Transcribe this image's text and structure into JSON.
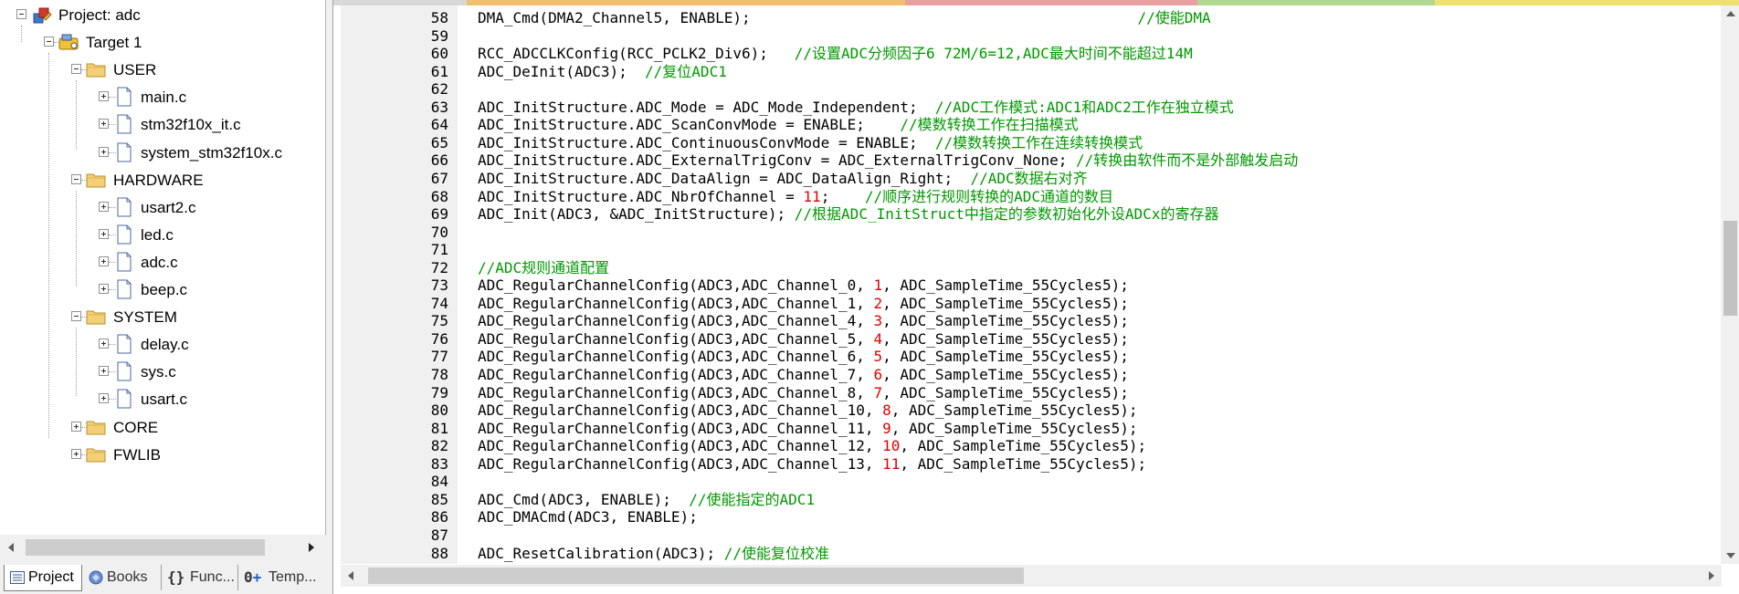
{
  "project_tree": [
    {
      "label": "Project: adc",
      "level": 0,
      "toggle": "minus",
      "icon": "project-icon"
    },
    {
      "label": "Target 1",
      "level": 1,
      "toggle": "minus",
      "icon": "target-icon"
    },
    {
      "label": "USER",
      "level": 2,
      "toggle": "minus",
      "icon": "folder-icon"
    },
    {
      "label": "main.c",
      "level": 3,
      "toggle": "plus",
      "icon": "file-icon"
    },
    {
      "label": "stm32f10x_it.c",
      "level": 3,
      "toggle": "plus",
      "icon": "file-icon"
    },
    {
      "label": "system_stm32f10x.c",
      "level": 3,
      "toggle": "plus",
      "icon": "file-icon"
    },
    {
      "label": "HARDWARE",
      "level": 2,
      "toggle": "minus",
      "icon": "folder-icon"
    },
    {
      "label": "usart2.c",
      "level": 3,
      "toggle": "plus",
      "icon": "file-icon"
    },
    {
      "label": "led.c",
      "level": 3,
      "toggle": "plus",
      "icon": "file-icon"
    },
    {
      "label": "adc.c",
      "level": 3,
      "toggle": "plus",
      "icon": "file-icon"
    },
    {
      "label": "beep.c",
      "level": 3,
      "toggle": "plus",
      "icon": "file-icon"
    },
    {
      "label": "SYSTEM",
      "level": 2,
      "toggle": "minus",
      "icon": "folder-icon"
    },
    {
      "label": "delay.c",
      "level": 3,
      "toggle": "plus",
      "icon": "file-icon"
    },
    {
      "label": "sys.c",
      "level": 3,
      "toggle": "plus",
      "icon": "file-icon"
    },
    {
      "label": "usart.c",
      "level": 3,
      "toggle": "plus",
      "icon": "file-icon"
    },
    {
      "label": "CORE",
      "level": 2,
      "toggle": "plus",
      "icon": "folder-icon"
    },
    {
      "label": "FWLIB",
      "level": 2,
      "toggle": "plus",
      "icon": "folder-icon"
    }
  ],
  "tabs": [
    {
      "label": "Project",
      "icon": "project-tab-icon",
      "active": true
    },
    {
      "label": "Books",
      "icon": "books-icon",
      "active": false
    },
    {
      "label": "Func...",
      "icon": "functions-icon",
      "active": false
    },
    {
      "label": "Temp...",
      "icon": "templates-icon",
      "active": false
    }
  ],
  "colors": {
    "comment": "#009900",
    "number": "#e00000",
    "text": "#000000"
  },
  "code_lines": [
    {
      "n": "58",
      "parts": [
        [
          "t",
          "DMA_Cmd(DMA2_Channel5, ENABLE);                                            "
        ],
        [
          "c",
          "//使能DMA"
        ]
      ]
    },
    {
      "n": "59",
      "parts": []
    },
    {
      "n": "60",
      "parts": [
        [
          "t",
          "RCC_ADCCLKConfig(RCC_PCLK2_Div6);   "
        ],
        [
          "c",
          "//设置ADC分频因子6 72M/6=12,ADC最大时间不能超过14M"
        ]
      ]
    },
    {
      "n": "61",
      "parts": [
        [
          "t",
          "ADC_DeInit(ADC3);  "
        ],
        [
          "c",
          "//复位ADC1"
        ]
      ]
    },
    {
      "n": "62",
      "parts": []
    },
    {
      "n": "63",
      "parts": [
        [
          "t",
          "ADC_InitStructure.ADC_Mode = ADC_Mode_Independent;  "
        ],
        [
          "c",
          "//ADC工作模式:ADC1和ADC2工作在独立模式"
        ]
      ]
    },
    {
      "n": "64",
      "parts": [
        [
          "t",
          "ADC_InitStructure.ADC_ScanConvMode = ENABLE;    "
        ],
        [
          "c",
          "//模数转换工作在扫描模式"
        ]
      ]
    },
    {
      "n": "65",
      "parts": [
        [
          "t",
          "ADC_InitStructure.ADC_ContinuousConvMode = ENABLE;  "
        ],
        [
          "c",
          "//模数转换工作在连续转换模式"
        ]
      ]
    },
    {
      "n": "66",
      "parts": [
        [
          "t",
          "ADC_InitStructure.ADC_ExternalTrigConv = ADC_ExternalTrigConv_None; "
        ],
        [
          "c",
          "//转换由软件而不是外部触发启动"
        ]
      ]
    },
    {
      "n": "67",
      "parts": [
        [
          "t",
          "ADC_InitStructure.ADC_DataAlign = ADC_DataAlign_Right;  "
        ],
        [
          "c",
          "//ADC数据右对齐"
        ]
      ]
    },
    {
      "n": "68",
      "parts": [
        [
          "t",
          "ADC_InitStructure.ADC_NbrOfChannel = "
        ],
        [
          "n",
          "11"
        ],
        [
          "t",
          ";    "
        ],
        [
          "c",
          "//顺序进行规则转换的ADC通道的数目"
        ]
      ]
    },
    {
      "n": "69",
      "parts": [
        [
          "t",
          "ADC_Init(ADC3, &ADC_InitStructure); "
        ],
        [
          "c",
          "//根据ADC_InitStruct中指定的参数初始化外设ADCx的寄存器"
        ]
      ]
    },
    {
      "n": "70",
      "parts": []
    },
    {
      "n": "71",
      "parts": []
    },
    {
      "n": "72",
      "parts": [
        [
          "c",
          "//ADC规则通道配置"
        ]
      ]
    },
    {
      "n": "73",
      "parts": [
        [
          "t",
          "ADC_RegularChannelConfig(ADC3,ADC_Channel_0, "
        ],
        [
          "n",
          "1"
        ],
        [
          "t",
          ", ADC_SampleTime_55Cycles5);"
        ]
      ]
    },
    {
      "n": "74",
      "parts": [
        [
          "t",
          "ADC_RegularChannelConfig(ADC3,ADC_Channel_1, "
        ],
        [
          "n",
          "2"
        ],
        [
          "t",
          ", ADC_SampleTime_55Cycles5);"
        ]
      ]
    },
    {
      "n": "75",
      "parts": [
        [
          "t",
          "ADC_RegularChannelConfig(ADC3,ADC_Channel_4, "
        ],
        [
          "n",
          "3"
        ],
        [
          "t",
          ", ADC_SampleTime_55Cycles5);"
        ]
      ]
    },
    {
      "n": "76",
      "parts": [
        [
          "t",
          "ADC_RegularChannelConfig(ADC3,ADC_Channel_5, "
        ],
        [
          "n",
          "4"
        ],
        [
          "t",
          ", ADC_SampleTime_55Cycles5);"
        ]
      ]
    },
    {
      "n": "77",
      "parts": [
        [
          "t",
          "ADC_RegularChannelConfig(ADC3,ADC_Channel_6, "
        ],
        [
          "n",
          "5"
        ],
        [
          "t",
          ", ADC_SampleTime_55Cycles5);"
        ]
      ]
    },
    {
      "n": "78",
      "parts": [
        [
          "t",
          "ADC_RegularChannelConfig(ADC3,ADC_Channel_7, "
        ],
        [
          "n",
          "6"
        ],
        [
          "t",
          ", ADC_SampleTime_55Cycles5);"
        ]
      ]
    },
    {
      "n": "79",
      "parts": [
        [
          "t",
          "ADC_RegularChannelConfig(ADC3,ADC_Channel_8, "
        ],
        [
          "n",
          "7"
        ],
        [
          "t",
          ", ADC_SampleTime_55Cycles5);"
        ]
      ]
    },
    {
      "n": "80",
      "parts": [
        [
          "t",
          "ADC_RegularChannelConfig(ADC3,ADC_Channel_10, "
        ],
        [
          "n",
          "8"
        ],
        [
          "t",
          ", ADC_SampleTime_55Cycles5);"
        ]
      ]
    },
    {
      "n": "81",
      "parts": [
        [
          "t",
          "ADC_RegularChannelConfig(ADC3,ADC_Channel_11, "
        ],
        [
          "n",
          "9"
        ],
        [
          "t",
          ", ADC_SampleTime_55Cycles5);"
        ]
      ]
    },
    {
      "n": "82",
      "parts": [
        [
          "t",
          "ADC_RegularChannelConfig(ADC3,ADC_Channel_12, "
        ],
        [
          "n",
          "10"
        ],
        [
          "t",
          ", ADC_SampleTime_55Cycles5);"
        ]
      ]
    },
    {
      "n": "83",
      "parts": [
        [
          "t",
          "ADC_RegularChannelConfig(ADC3,ADC_Channel_13, "
        ],
        [
          "n",
          "11"
        ],
        [
          "t",
          ", ADC_SampleTime_55Cycles5);"
        ]
      ]
    },
    {
      "n": "84",
      "parts": []
    },
    {
      "n": "85",
      "parts": [
        [
          "t",
          "ADC_Cmd(ADC3, ENABLE);  "
        ],
        [
          "c",
          "//使能指定的ADC1"
        ]
      ]
    },
    {
      "n": "86",
      "parts": [
        [
          "t",
          "ADC_DMACmd(ADC3, ENABLE);"
        ]
      ]
    },
    {
      "n": "87",
      "parts": []
    },
    {
      "n": "88",
      "parts": [
        [
          "t",
          "ADC_ResetCalibration(ADC3); "
        ],
        [
          "c",
          "//使能复位校准"
        ]
      ]
    }
  ]
}
